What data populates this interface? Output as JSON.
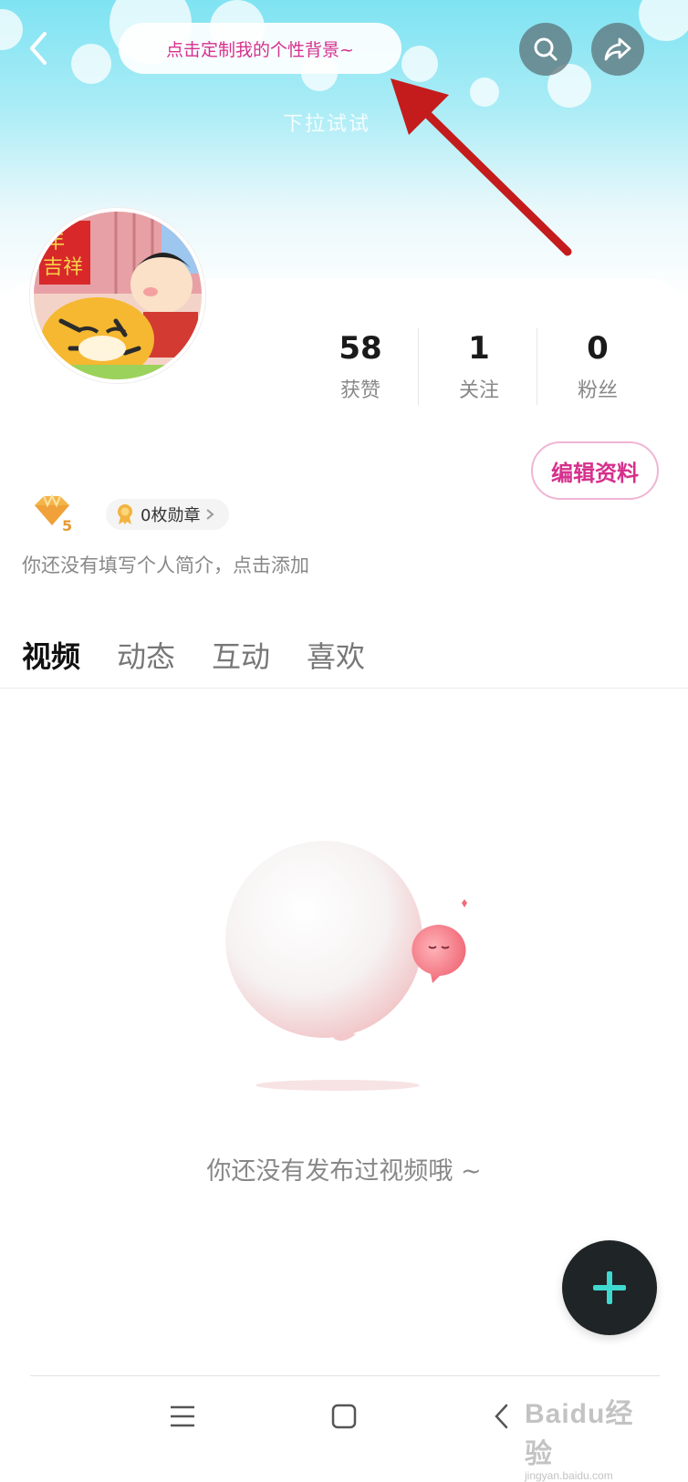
{
  "header": {
    "tip_text": "点击定制我的个性背景~",
    "pull_hint": "下拉试试"
  },
  "stats": [
    {
      "value": "58",
      "label": "获赞"
    },
    {
      "value": "1",
      "label": "关注"
    },
    {
      "value": "0",
      "label": "粉丝"
    }
  ],
  "profile": {
    "edit_button": "编辑资料",
    "level": "5",
    "medals": "0枚勋章",
    "bio_placeholder": "你还没有填写个人简介，点击添加",
    "avatar_text": "年 吉祥"
  },
  "tabs": [
    {
      "label": "视频",
      "active": true
    },
    {
      "label": "动态",
      "active": false
    },
    {
      "label": "互动",
      "active": false
    },
    {
      "label": "喜欢",
      "active": false
    }
  ],
  "empty_state": {
    "message": "你还没有发布过视频哦 ~"
  },
  "watermark": {
    "main": "Baidu经验",
    "sub": "jingyan.baidu.com"
  },
  "colors": {
    "accent_pink": "#d6308d",
    "fab_plus": "#3fd9d0",
    "arrow": "#c41c1c"
  },
  "icons": {
    "back": "chevron-left-icon",
    "search": "search-icon",
    "share": "share-icon",
    "plus": "plus-icon",
    "menu": "menu-icon",
    "home": "home-square-icon",
    "nav_back": "nav-back-icon"
  }
}
